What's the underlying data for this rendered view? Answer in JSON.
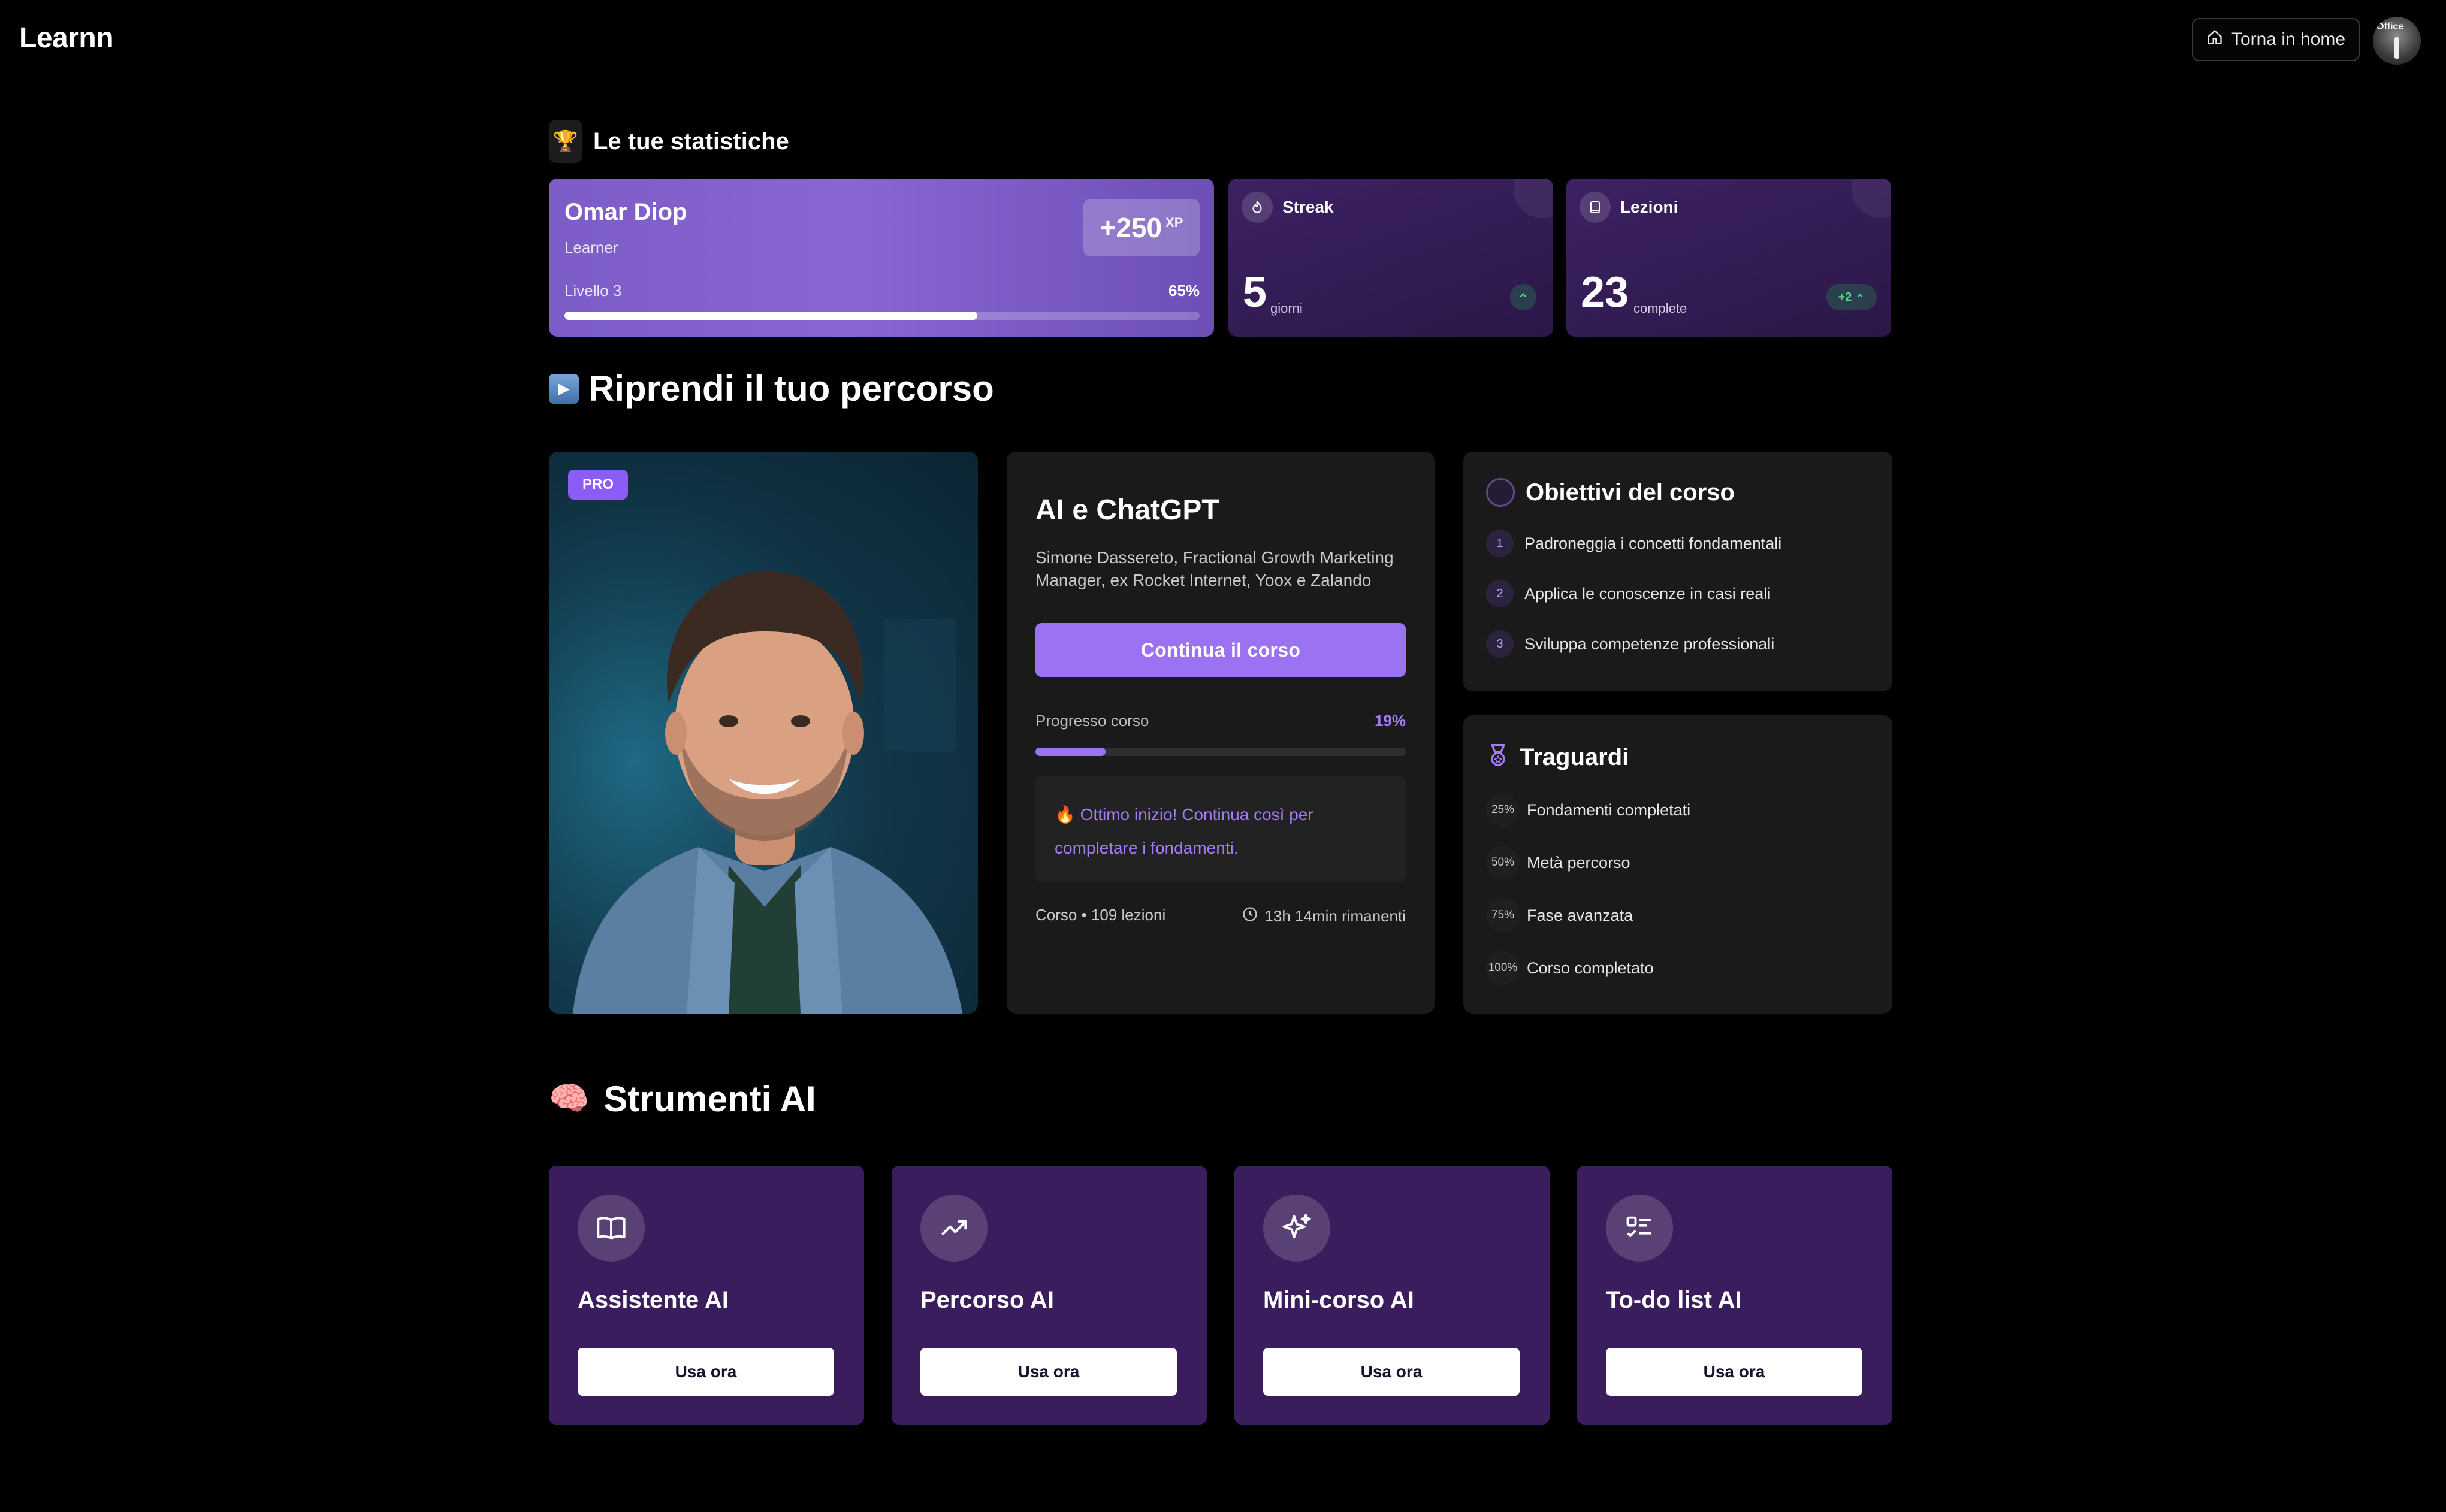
{
  "header": {
    "logo": "Learnn",
    "home_button": "Torna in home",
    "avatar_text": "Office"
  },
  "stats": {
    "title": "Le tue statistiche",
    "user": {
      "name": "Omar Diop",
      "role": "Learner",
      "xp": "+250",
      "xp_unit": "XP",
      "level": "Livello 3",
      "level_percent": "65%",
      "level_progress": 0.65
    },
    "streak": {
      "label": "Streak",
      "value": "5",
      "unit": "giorni"
    },
    "lessons": {
      "label": "Lezioni",
      "value": "23",
      "unit": "complete",
      "delta": "+2"
    }
  },
  "resume": {
    "title": "Riprendi il tuo percorso",
    "badge": "PRO",
    "course": {
      "title": "AI e ChatGPT",
      "author": "Simone Dassereto, Fractional Growth Marketing Manager, ex Rocket Internet, Yoox e Zalando",
      "cta": "Continua il corso",
      "progress_label": "Progresso corso",
      "progress_percent": "19%",
      "progress": 0.19,
      "message": "🔥 Ottimo inizio! Continua così per completare i fondamenti.",
      "meta": "Corso • 109 lezioni",
      "remaining": "13h 14min rimanenti"
    },
    "objectives": {
      "title": "Obiettivi del corso",
      "items": [
        {
          "num": "1",
          "text": "Padroneggia i concetti fondamentali"
        },
        {
          "num": "2",
          "text": "Applica le conoscenze in casi reali"
        },
        {
          "num": "3",
          "text": "Sviluppa competenze professionali"
        }
      ]
    },
    "milestones": {
      "title": "Traguardi",
      "items": [
        {
          "pct": "25%",
          "text": "Fondamenti completati"
        },
        {
          "pct": "50%",
          "text": "Metà percorso"
        },
        {
          "pct": "75%",
          "text": "Fase avanzata"
        },
        {
          "pct": "100%",
          "text": "Corso completato"
        }
      ]
    }
  },
  "tools": {
    "title": "Strumenti AI",
    "items": [
      {
        "name": "Assistente AI",
        "button": "Usa ora",
        "icon": "book-icon"
      },
      {
        "name": "Percorso AI",
        "button": "Usa ora",
        "icon": "trending-up-icon"
      },
      {
        "name": "Mini-corso AI",
        "button": "Usa ora",
        "icon": "sparkles-icon"
      },
      {
        "name": "To-do list AI",
        "button": "Usa ora",
        "icon": "checklist-icon"
      }
    ]
  },
  "colors": {
    "accent": "#9b72f2",
    "xp_card": "#7c5cc7",
    "tool_card": "#3a1d5c",
    "card_bg": "#1a1a1a",
    "trend_green": "#4ee08e"
  }
}
